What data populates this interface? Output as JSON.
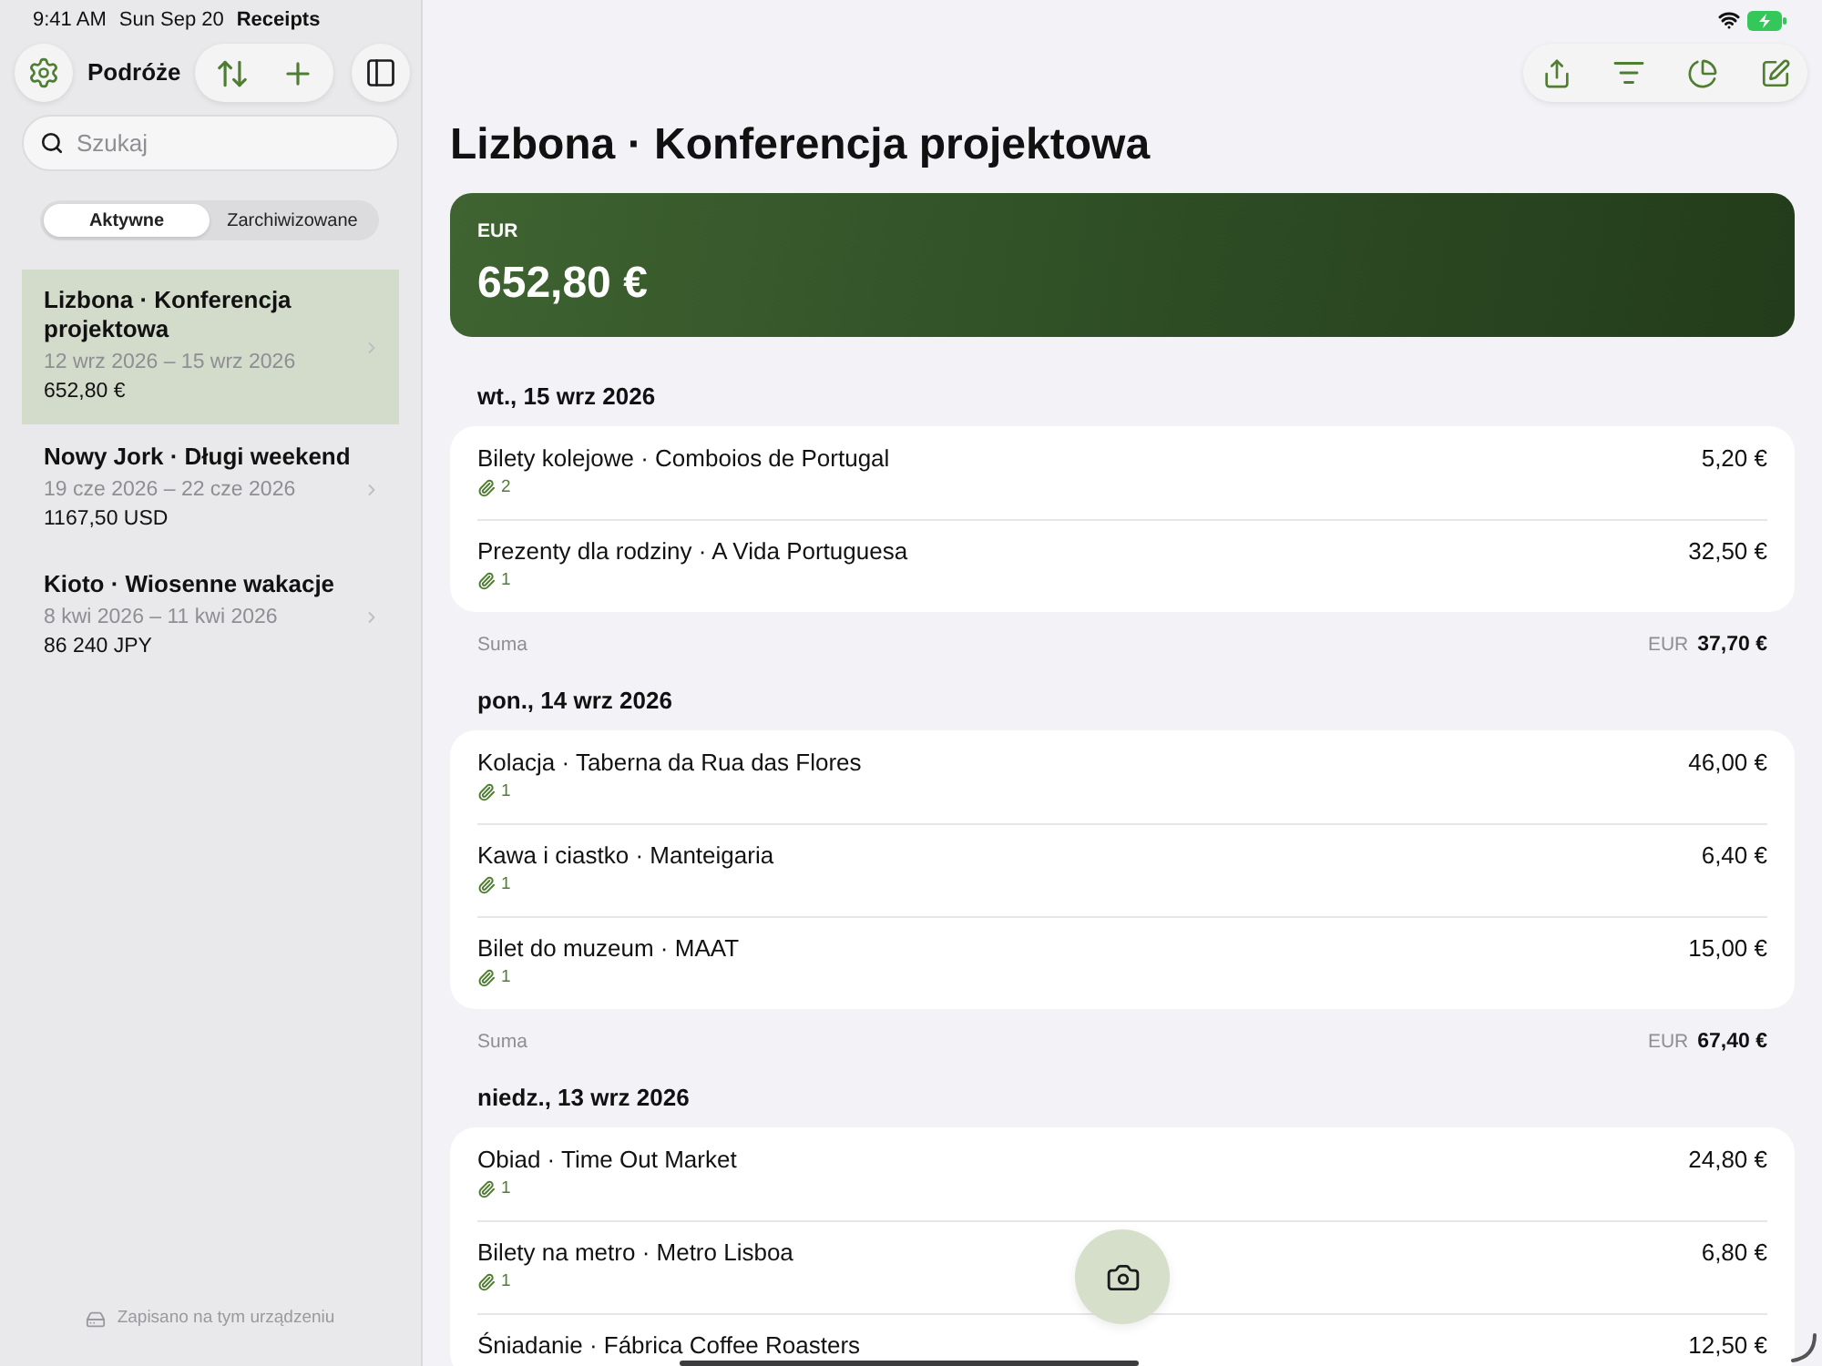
{
  "status_bar": {
    "time": "9:41 AM",
    "date": "Sun Sep 20",
    "app": "Receipts"
  },
  "sidebar": {
    "title": "Podróże",
    "search": {
      "placeholder": "Szukaj"
    },
    "segments": [
      {
        "label": "Aktywne",
        "selected": true
      },
      {
        "label": "Zarchiwizowane",
        "selected": false
      }
    ],
    "trips": [
      {
        "title": "Lizbona · Konferencja projektowa",
        "dates": "12 wrz 2026 – 15 wrz 2026",
        "total": "652,80 €",
        "selected": true
      },
      {
        "title": "Nowy Jork · Długi weekend",
        "dates": "19 cze 2026 – 22 cze 2026",
        "total": "1167,50 USD",
        "selected": false
      },
      {
        "title": "Kioto · Wiosenne wakacje",
        "dates": "8 kwi 2026 – 11 kwi 2026",
        "total": "86 240 JPY",
        "selected": false
      }
    ],
    "footer": "Zapisano na tym urządzeniu"
  },
  "trip": {
    "title": "Lizbona · Konferencja projektowa",
    "currency": "EUR",
    "total": "652,80 €",
    "days": [
      {
        "date": "wt., 15 wrz 2026",
        "receipts": [
          {
            "title": "Bilety kolejowe · Comboios de Portugal",
            "attachments": "2",
            "amount": "5,20 €"
          },
          {
            "title": "Prezenty dla rodziny · A Vida Portuguesa",
            "attachments": "1",
            "amount": "32,50 €"
          }
        ],
        "sum": {
          "label": "Suma",
          "currency": "EUR",
          "amount": "37,70 €"
        }
      },
      {
        "date": "pon., 14 wrz 2026",
        "receipts": [
          {
            "title": "Kolacja · Taberna da Rua das Flores",
            "attachments": "1",
            "amount": "46,00 €"
          },
          {
            "title": "Kawa i ciastko · Manteigaria",
            "attachments": "1",
            "amount": "6,40 €"
          },
          {
            "title": "Bilet do muzeum · MAAT",
            "attachments": "1",
            "amount": "15,00 €"
          }
        ],
        "sum": {
          "label": "Suma",
          "currency": "EUR",
          "amount": "67,40 €"
        }
      },
      {
        "date": "niedz., 13 wrz 2026",
        "receipts": [
          {
            "title": "Obiad · Time Out Market",
            "attachments": "1",
            "amount": "24,80 €"
          },
          {
            "title": "Bilety na metro · Metro Lisboa",
            "attachments": "1",
            "amount": "6,80 €"
          },
          {
            "title": "Śniadanie · Fábrica Coffee Roasters",
            "amount": "12,50 €"
          }
        ]
      }
    ]
  }
}
